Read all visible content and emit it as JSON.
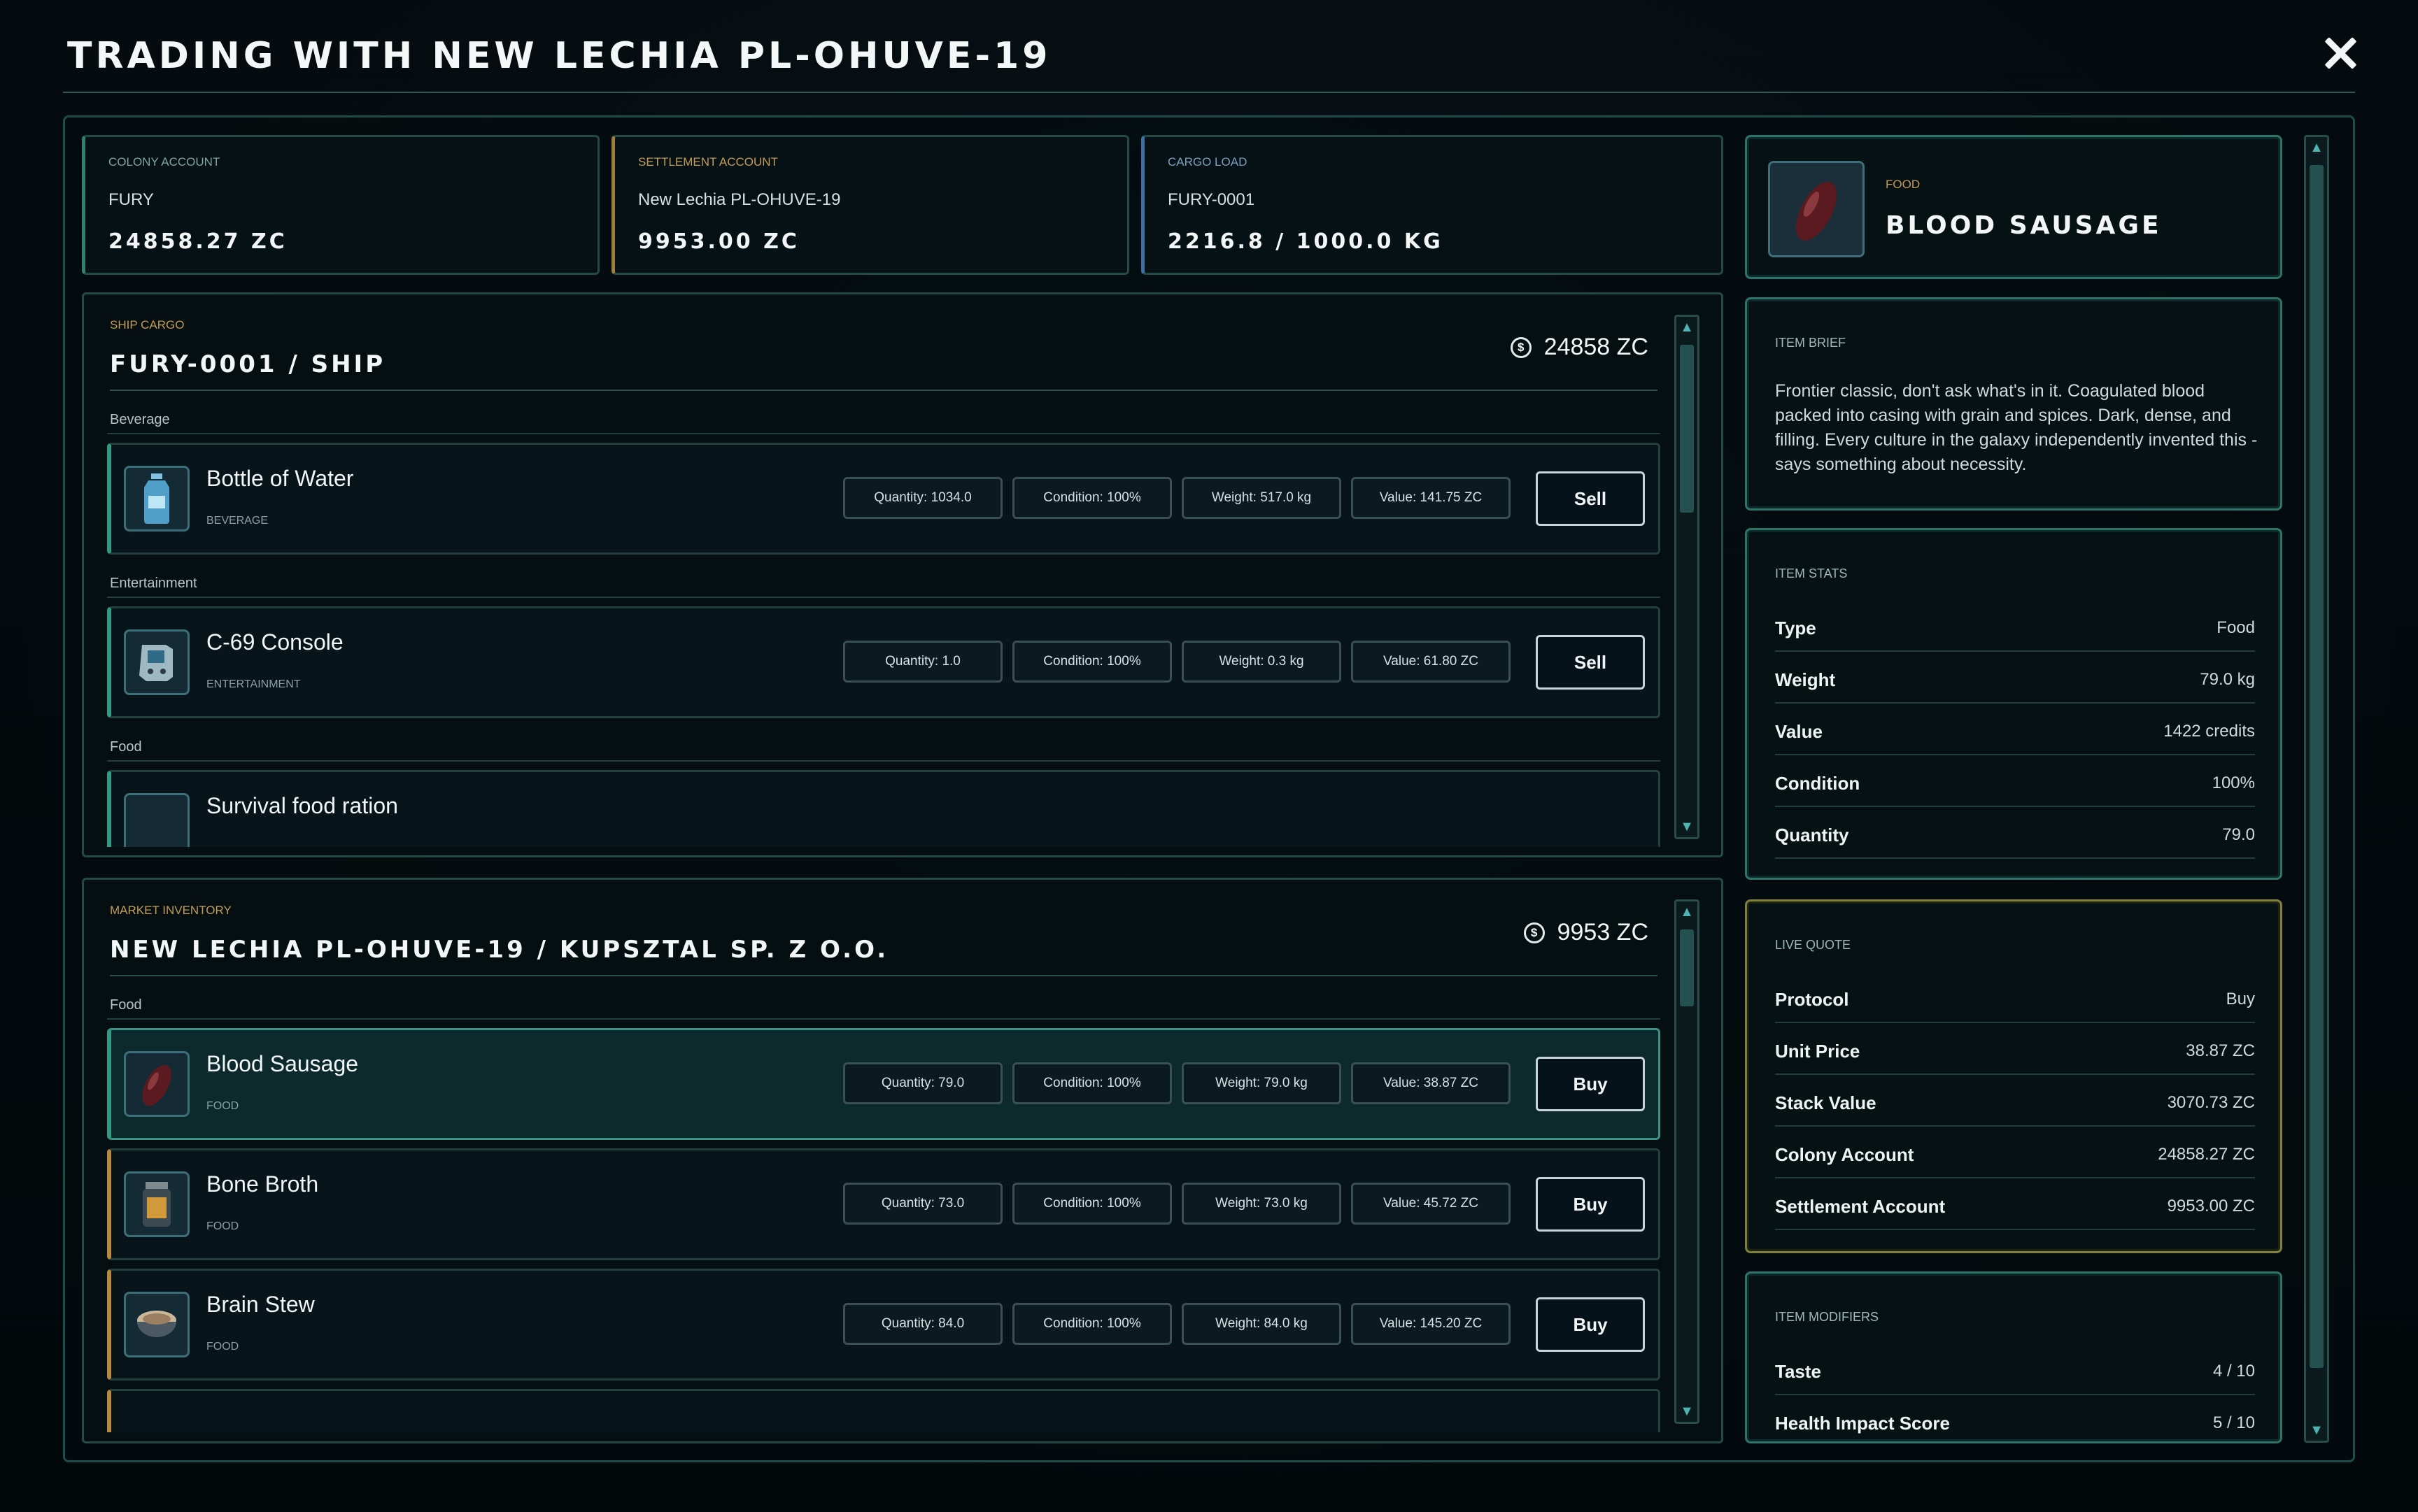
{
  "header": {
    "title": "Trading with New Lechia PL-OHUVE-19"
  },
  "accounts": [
    {
      "label": "Colony Account",
      "name": "FURY",
      "value": "24858.27 ZC"
    },
    {
      "label": "Settlement Account",
      "name": "New Lechia PL-OHUVE-19",
      "value": "9953.00 ZC"
    },
    {
      "label": "Cargo Load",
      "name": "FURY-0001",
      "value": "2216.8 / 1000.0 KG"
    }
  ],
  "ship": {
    "tag": "Ship Cargo",
    "title": "FURY-0001 / SHIP",
    "balance": "24858 ZC",
    "coin_symbol": "$",
    "categories": [
      "Beverage",
      "Entertainment",
      "Food"
    ],
    "items": [
      {
        "name": "Bottle of Water",
        "category": "Beverage",
        "quantity": "Quantity: 1034.0",
        "condition": "Condition: 100%",
        "weight": "Weight: 517.0 kg",
        "value": "Value: 141.75 ZC",
        "action": "Sell"
      },
      {
        "name": "C-69 Console",
        "category": "Entertainment",
        "quantity": "Quantity: 1.0",
        "condition": "Condition: 100%",
        "weight": "Weight: 0.3 kg",
        "value": "Value: 61.80 ZC",
        "action": "Sell"
      },
      {
        "name": "Survival food ration"
      }
    ]
  },
  "market": {
    "tag": "Market Inventory",
    "title": "NEW LECHIA PL-OHUVE-19 / KUPSZTAL SP. Z O.O.",
    "balance": "9953 ZC",
    "coin_symbol": "$",
    "category": "Food",
    "items": [
      {
        "name": "Blood Sausage",
        "category": "Food",
        "quantity": "Quantity: 79.0",
        "condition": "Condition: 100%",
        "weight": "Weight: 79.0 kg",
        "value": "Value: 38.87 ZC",
        "action": "Buy"
      },
      {
        "name": "Bone Broth",
        "category": "Food",
        "quantity": "Quantity: 73.0",
        "condition": "Condition: 100%",
        "weight": "Weight: 73.0 kg",
        "value": "Value: 45.72 ZC",
        "action": "Buy"
      },
      {
        "name": "Brain Stew",
        "category": "Food",
        "quantity": "Quantity: 84.0",
        "condition": "Condition: 100%",
        "weight": "Weight: 84.0 kg",
        "value": "Value: 145.20 ZC",
        "action": "Buy"
      }
    ]
  },
  "detail": {
    "tag": "Food",
    "name": "BLOOD SAUSAGE",
    "brief_label": "Item Brief",
    "brief": "Frontier classic, don't ask what's in it. Coagulated blood packed into casing with grain and spices. Dark, dense, and filling. Every culture in the galaxy independently invented this - says something about necessity.",
    "stats_label": "Item Stats",
    "stats": [
      {
        "k": "Type",
        "v": "Food"
      },
      {
        "k": "Weight",
        "v": "79.0 kg"
      },
      {
        "k": "Value",
        "v": "1422 credits"
      },
      {
        "k": "Condition",
        "v": "100%"
      },
      {
        "k": "Quantity",
        "v": "79.0"
      }
    ],
    "quote_label": "Live Quote",
    "quote": [
      {
        "k": "Protocol",
        "v": "Buy"
      },
      {
        "k": "Unit Price",
        "v": "38.87 ZC"
      },
      {
        "k": "Stack Value",
        "v": "3070.73 ZC"
      },
      {
        "k": "Colony Account",
        "v": "24858.27 ZC"
      },
      {
        "k": "Settlement Account",
        "v": "9953.00 ZC"
      }
    ],
    "mods_label": "Item Modifiers",
    "mods": [
      {
        "k": "Taste",
        "v": "4 / 10"
      },
      {
        "k": "Health Impact Score",
        "v": "5 / 10"
      }
    ]
  },
  "colors": {
    "accent": "#2f9c83",
    "amber": "#b98a3e",
    "border": "#244a48",
    "background": "#03080b"
  },
  "icons": {
    "close": "close-icon",
    "coin": "coin-icon",
    "scroll_up": "scroll-up-icon",
    "scroll_down": "scroll-down-icon"
  }
}
